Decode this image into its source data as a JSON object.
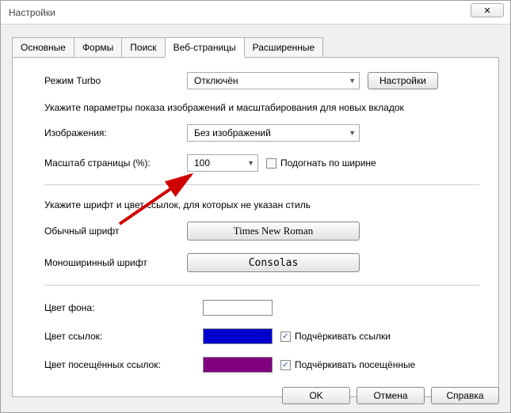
{
  "window": {
    "title": "Настройки",
    "close": "✕"
  },
  "tabs": {
    "t0": "Основные",
    "t1": "Формы",
    "t2": "Поиск",
    "t3": "Веб-страницы",
    "t4": "Расширенные"
  },
  "turbo": {
    "label": "Режим Turbo",
    "value": "Отключён",
    "settings_btn": "Настройки"
  },
  "images_section": {
    "desc": "Укажите параметры показа изображений и масштабирования для новых вкладок",
    "images_label": "Изображения:",
    "images_value": "Без изображений",
    "scale_label": "Масштаб страницы (%):",
    "scale_value": "100",
    "fit_width": "Подогнать по ширине",
    "fit_width_checked": false
  },
  "fonts_section": {
    "desc": "Укажите шрифт и цвет ссылок, для которых не указан стиль",
    "normal_label": "Обычный шрифт",
    "normal_value": "Times New Roman",
    "mono_label": "Моноширинный шрифт",
    "mono_value": "Consolas"
  },
  "colors_section": {
    "bg_label": "Цвет фона:",
    "bg_color": "#ffffff",
    "link_label": "Цвет ссылок:",
    "link_color": "#0000cc",
    "underline_links": "Подчёркивать ссылки",
    "underline_links_checked": true,
    "visited_label": "Цвет посещённых ссылок:",
    "visited_color": "#800080",
    "underline_visited": "Подчёркивать посещённые",
    "underline_visited_checked": true
  },
  "footer": {
    "ok": "OK",
    "cancel": "Отмена",
    "help": "Справка"
  }
}
